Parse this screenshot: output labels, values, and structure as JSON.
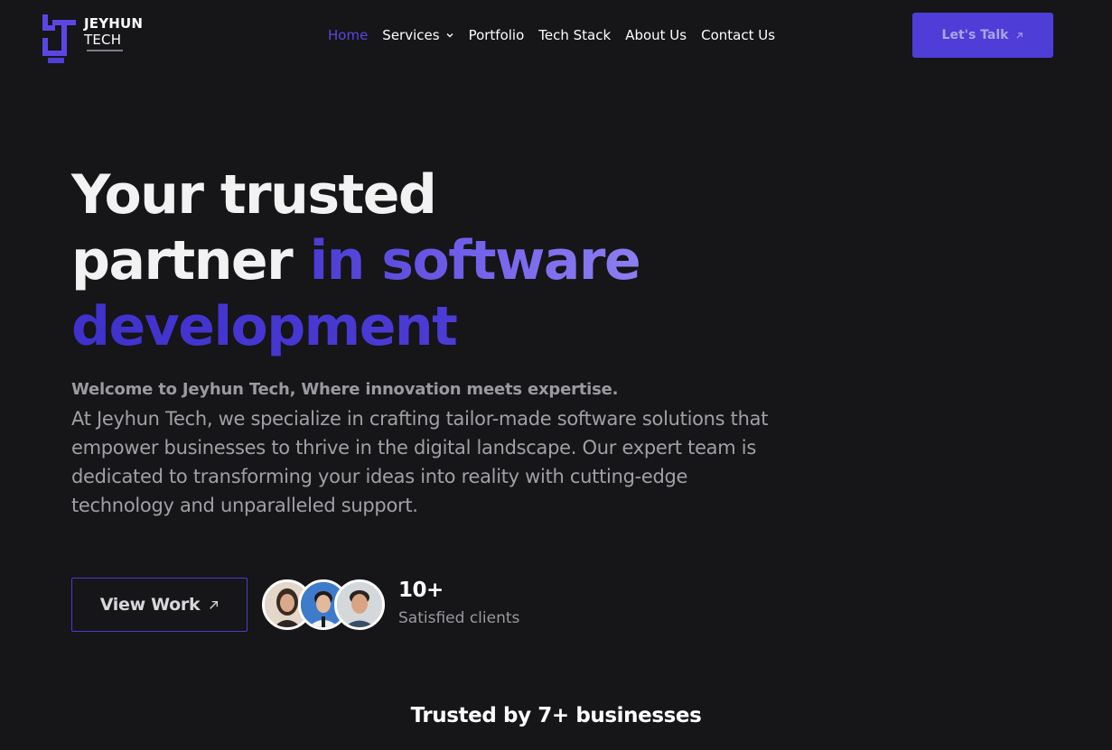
{
  "brand": {
    "name": "JEYHUN",
    "sub": "TECH",
    "accent": "#4f3dd8"
  },
  "nav": {
    "items": [
      {
        "label": "Home",
        "active": true
      },
      {
        "label": "Services",
        "has_dropdown": true
      },
      {
        "label": "Portfolio"
      },
      {
        "label": "Tech Stack"
      },
      {
        "label": "About Us"
      },
      {
        "label": "Contact Us"
      }
    ],
    "cta_label": "Let's Talk"
  },
  "hero": {
    "title_line1": "Your trusted",
    "title_line2_plain": "partner ",
    "title_line2_accent": "in software",
    "title_line3_accent": "development",
    "welcome": "Welcome to Jeyhun Tech, Where innovation meets expertise.",
    "description": "At Jeyhun Tech, we specialize in crafting tailor-made software solutions that empower businesses to thrive in the digital landscape. Our expert team is dedicated to transforming your ideas into reality with cutting-edge technology and unparalleled support.",
    "view_work_label": "View Work",
    "clients_count": "10+",
    "clients_label": "Satisfied clients"
  },
  "trusted": {
    "title": "Trusted by 7+ businesses"
  },
  "icons": {
    "logo": "jt-logo-icon",
    "dropdown": "chevron-down-icon",
    "arrow": "arrow-up-right-icon"
  }
}
